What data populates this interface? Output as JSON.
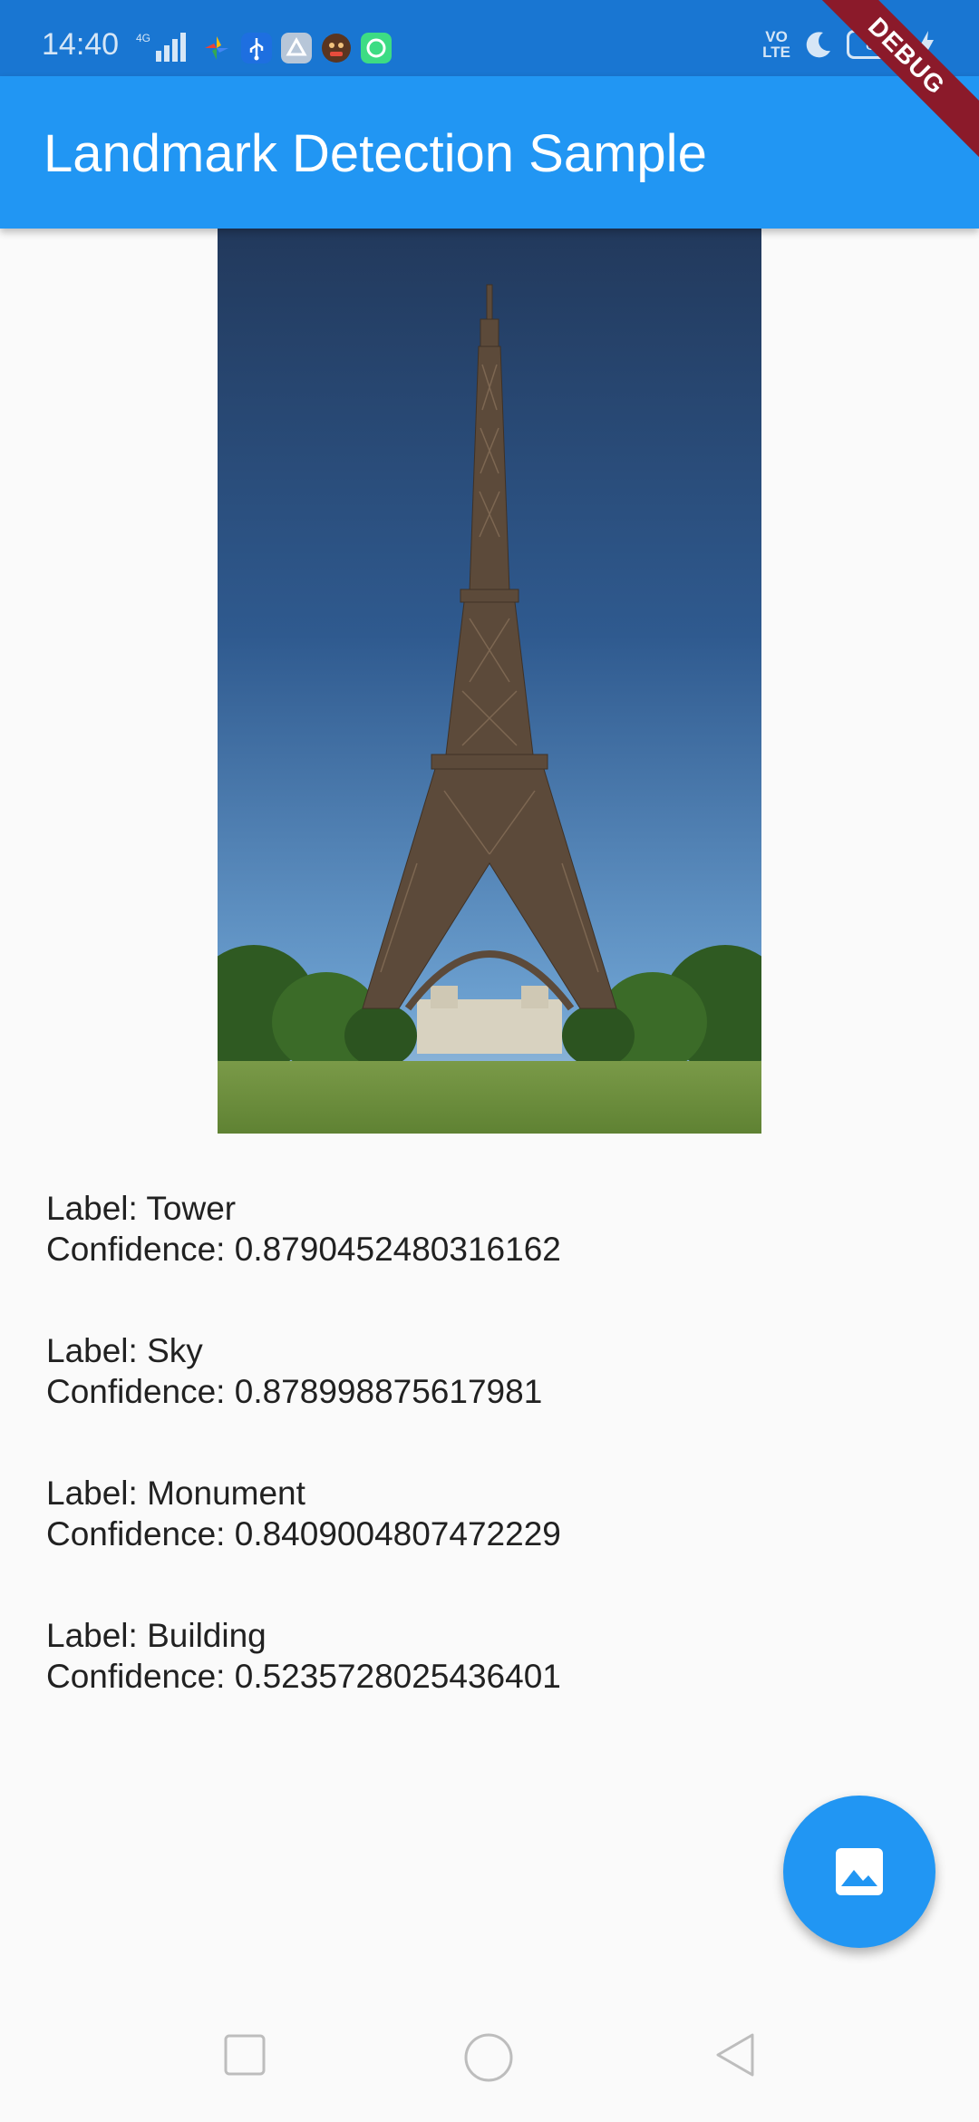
{
  "status_bar": {
    "time": "14:40",
    "network": "4G",
    "volte": [
      "VO",
      "LTE"
    ],
    "battery": "83",
    "icons": [
      "signal-icon",
      "photos-icon",
      "usb-icon",
      "drive-icon",
      "game-avatar-icon",
      "app-icon",
      "moon-icon",
      "charging-icon"
    ]
  },
  "app_bar": {
    "title": "Landmark Detection Sample"
  },
  "debug_banner": "DEBUG",
  "image": {
    "icon": "eiffel-tower-photo"
  },
  "results": [
    {
      "label": "Label: Tower",
      "confidence": "Confidence: 0.8790452480316162"
    },
    {
      "label": "Label: Sky",
      "confidence": "Confidence: 0.878998875617981"
    },
    {
      "label": "Label: Monument",
      "confidence": "Confidence: 0.8409004807472229"
    },
    {
      "label": "Label: Building",
      "confidence": "Confidence: 0.5235728025436401"
    }
  ],
  "fab": {
    "icon": "image-icon"
  },
  "nav": {
    "icons": [
      "recents-icon",
      "home-icon",
      "back-icon"
    ]
  },
  "colors": {
    "primary": "#2196f3",
    "status_bar": "#1976d2",
    "banner": "#8b1a2a"
  }
}
